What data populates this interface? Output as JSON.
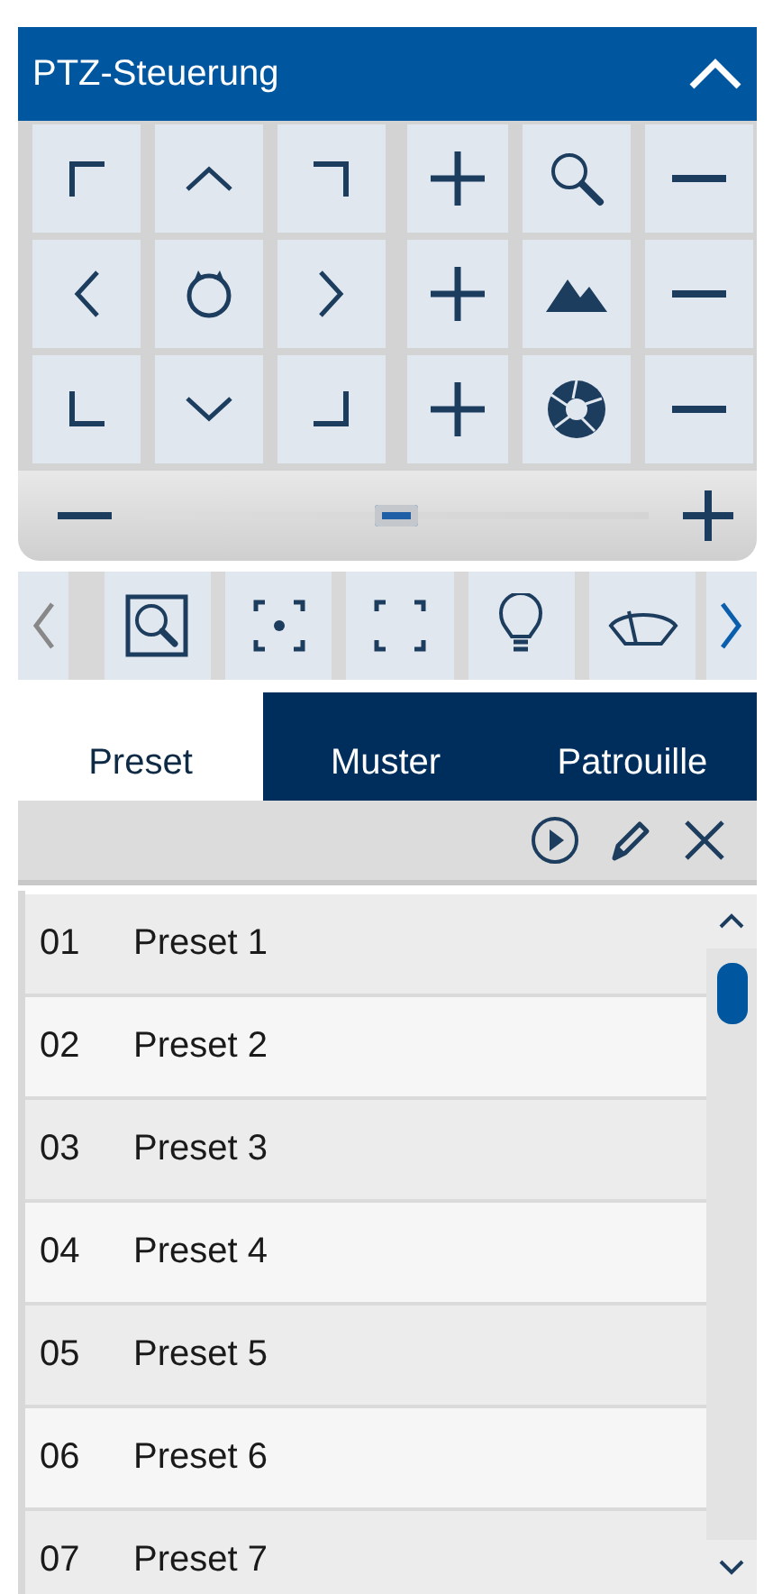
{
  "panel": {
    "title": "PTZ-Steuerung",
    "expanded": true
  },
  "speed_slider": {
    "level": 0.5
  },
  "tabs": [
    {
      "label": "Preset",
      "selected": true
    },
    {
      "label": "Muster",
      "selected": false
    },
    {
      "label": "Patrouille",
      "selected": false
    }
  ],
  "presets": [
    {
      "number": "01",
      "name": "Preset 1"
    },
    {
      "number": "02",
      "name": "Preset 2"
    },
    {
      "number": "03",
      "name": "Preset 3"
    },
    {
      "number": "04",
      "name": "Preset 4"
    },
    {
      "number": "05",
      "name": "Preset 5"
    },
    {
      "number": "06",
      "name": "Preset 6"
    },
    {
      "number": "07",
      "name": "Preset 7"
    }
  ]
}
